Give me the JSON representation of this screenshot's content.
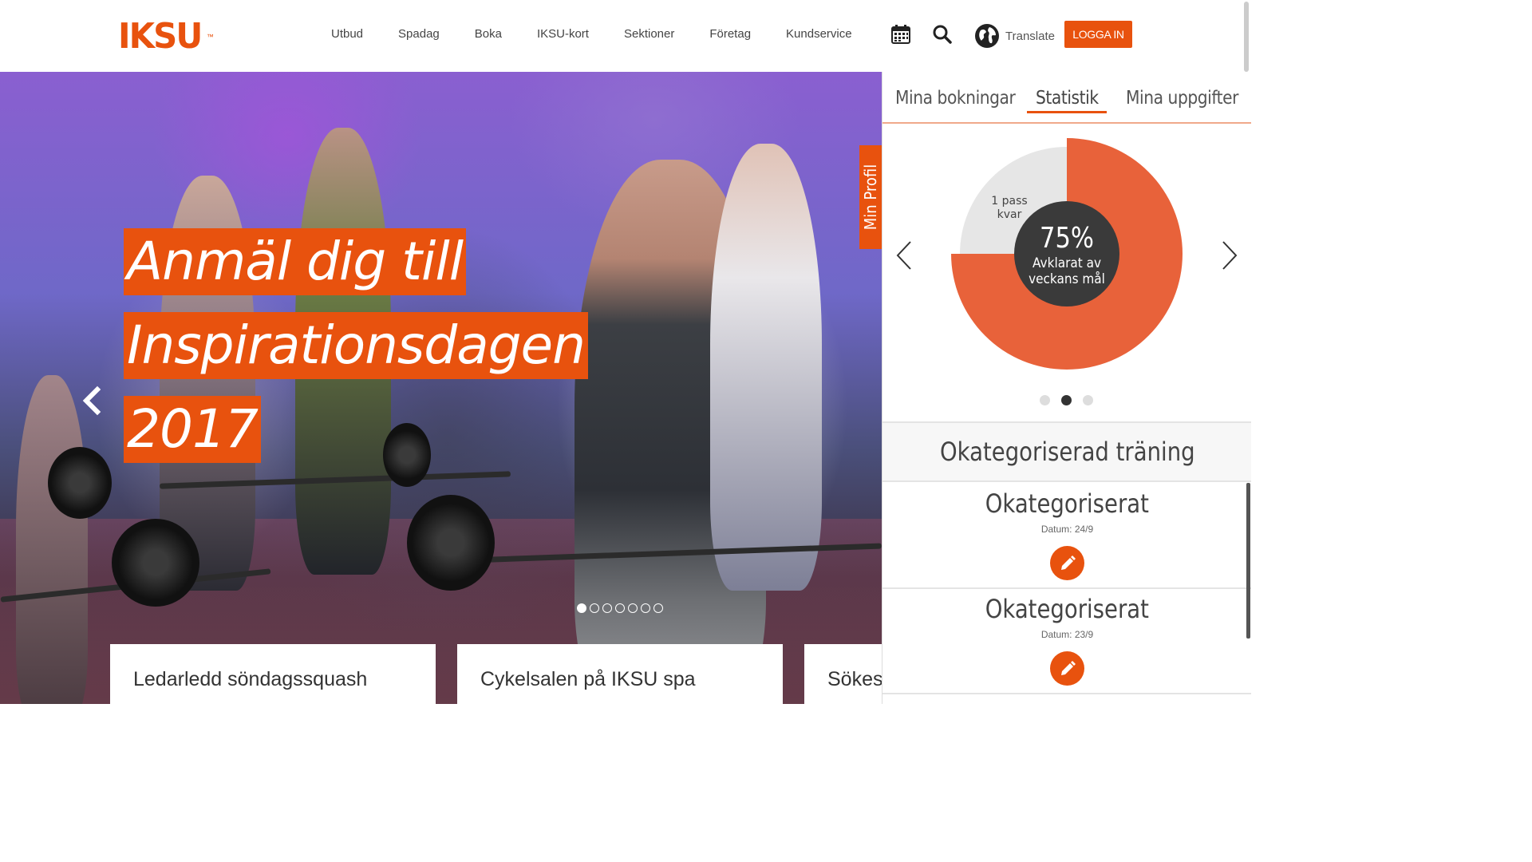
{
  "brand": {
    "logo": "IKSU",
    "color": "#e8520e"
  },
  "nav": {
    "items": [
      "Utbud",
      "Spadag",
      "Boka",
      "IKSU-kort",
      "Sektioner",
      "Företag",
      "Kundservice"
    ]
  },
  "header": {
    "calendar_icon": "calendar-icon",
    "search_icon": "search-icon",
    "globe_icon": "globe-icon",
    "translate_label": "Translate",
    "login_label": "LOGGA IN"
  },
  "hero": {
    "headline": [
      "Anmäl dig till",
      "Inspirationsdagen",
      "2017"
    ],
    "slide_count": 7,
    "active_slide": 1
  },
  "profile_tab": {
    "label": "Min Profil"
  },
  "cards": [
    {
      "title": "Ledarledd söndagssquash"
    },
    {
      "title": "Cykelsalen på IKSU spa"
    },
    {
      "title": "Sökes"
    }
  ],
  "panel": {
    "tabs": [
      "Mina bokningar",
      "Statistik",
      "Mina uppgifter"
    ],
    "active_tab": "Statistik",
    "stat": {
      "percent_label": "75%",
      "caption_line1": "Avklarat av",
      "caption_line2": "veckans mål",
      "remaining_line1": "1 pass",
      "remaining_line2": "kvar",
      "completed_fraction": 0.75,
      "completed_color": "#e8623a",
      "remaining_color": "#e6e6e6"
    },
    "stat_pages": 3,
    "stat_active_page": 2,
    "category_title": "Okategoriserad träning",
    "entries": [
      {
        "title": "Okategoriserat",
        "date": "Datum: 24/9"
      },
      {
        "title": "Okategoriserat",
        "date": "Datum: 23/9"
      }
    ]
  }
}
